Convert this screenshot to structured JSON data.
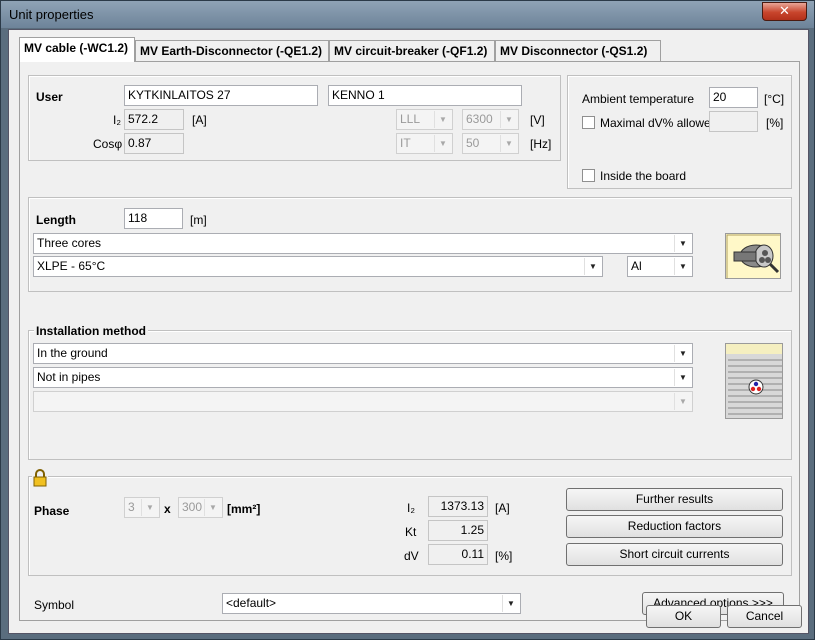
{
  "window": {
    "title": "Unit properties",
    "close_glyph": "✕"
  },
  "tabs": [
    {
      "label": "MV cable (-WC1.2)",
      "active": true
    },
    {
      "label": "MV Earth-Disconnector (-QE1.2)",
      "active": false
    },
    {
      "label": "MV circuit-breaker (-QF1.2)",
      "active": false
    },
    {
      "label": "MV Disconnector (-QS1.2)",
      "active": false
    }
  ],
  "user": {
    "label": "User",
    "name1": "KYTKINLAITOS 27",
    "name2": "KENNO 1",
    "ib_label": "I₂",
    "ib_value": "572.2",
    "ib_unit": "[A]",
    "cos_label": "Cosφ",
    "cos_value": "0.87",
    "system": "LLL",
    "voltage": "6300",
    "voltage_unit": "[V]",
    "earthing": "IT",
    "frequency": "50",
    "frequency_unit": "[Hz]"
  },
  "ambient": {
    "label": "Ambient temperature",
    "value": "20",
    "unit": "[°C]",
    "maxdv_label": "Maximal dV% allowed",
    "maxdv_value": "",
    "maxdv_unit": "[%]",
    "inside_label": "Inside the board"
  },
  "length": {
    "label": "Length",
    "value": "118",
    "unit": "[m]",
    "cores": "Three cores",
    "insulation": "XLPE - 65°C",
    "material": "Al"
  },
  "installation": {
    "label": "Installation method",
    "method": "In the ground",
    "pipes": "Not in pipes",
    "extra": ""
  },
  "phase": {
    "label": "Phase",
    "count": "3",
    "x": "x",
    "size": "300",
    "unit": "[mm²]",
    "iz_label": "I₂",
    "iz_value": "1373.13",
    "iz_unit": "[A]",
    "kt_label": "Kt",
    "kt_value": "1.25",
    "dv_label": "dV",
    "dv_value": "0.11",
    "dv_unit": "[%]"
  },
  "buttons": {
    "further": "Further results",
    "reduction": "Reduction factors",
    "short_circuit": "Short circuit currents",
    "advanced": "Advanced options >>>",
    "ok": "OK",
    "cancel": "Cancel"
  },
  "symbol": {
    "label": "Symbol",
    "value": "<default>"
  }
}
